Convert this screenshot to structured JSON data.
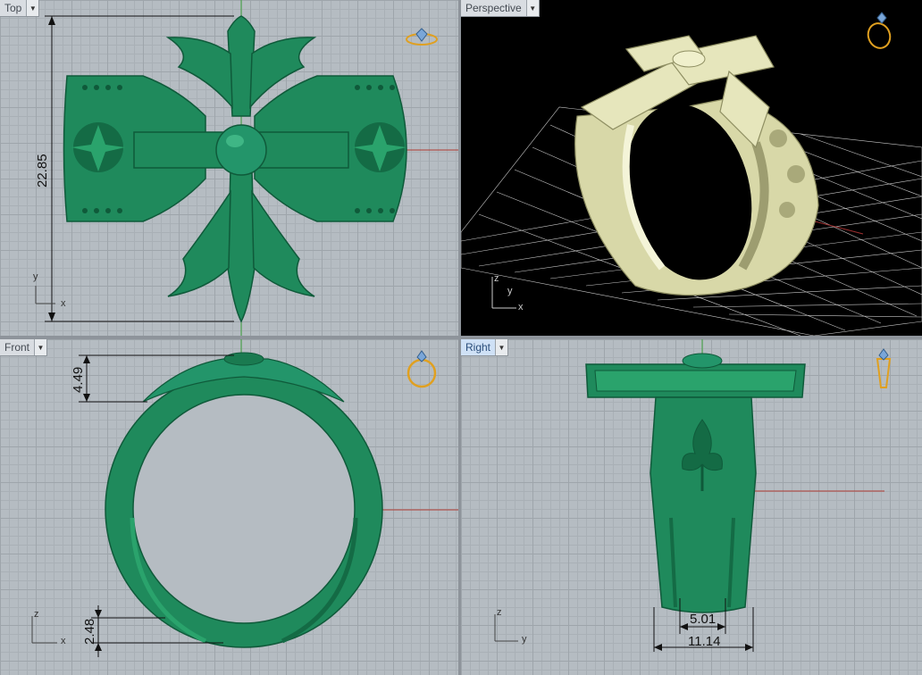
{
  "viewports": {
    "top": {
      "label": "Top",
      "dimension": "22.85",
      "axis_v": "y",
      "axis_h": "x"
    },
    "perspective": {
      "label": "Perspective",
      "axis_v": "z",
      "axis_mid": "y",
      "axis_h": "x"
    },
    "front": {
      "label": "Front",
      "dimension_top": "4.49",
      "dimension_bottom": "2.48",
      "axis_v": "z",
      "axis_h": "x"
    },
    "right": {
      "label": "Right",
      "dimension_inner": "5.01",
      "dimension_outer": "11.14",
      "axis_v": "z",
      "axis_h": "y"
    }
  },
  "colors": {
    "model_green": "#1f8a5c",
    "model_green_dark": "#0f5a3a",
    "model_gold": "#d8d8a8",
    "grid_bg": "#b5bcc2",
    "axis_red": "#b03a32",
    "axis_green": "#3aa03a"
  }
}
